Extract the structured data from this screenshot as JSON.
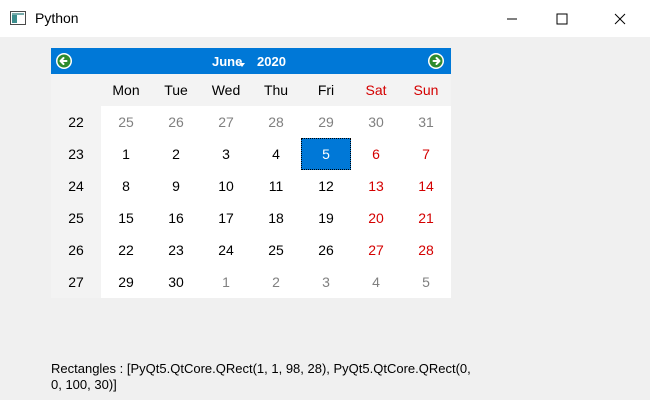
{
  "window": {
    "title": "Python",
    "buttons": [
      "minimize-icon",
      "maximize-icon",
      "close-icon"
    ]
  },
  "calendar": {
    "month": "June",
    "year": "2020",
    "nav": {
      "prev_icon": "left-arrow-icon",
      "next_icon": "right-arrow-icon",
      "month_menu_icon": "dropdown-icon"
    },
    "day_headers": [
      "Mon",
      "Tue",
      "Wed",
      "Thu",
      "Fri",
      "Sat",
      "Sun"
    ],
    "weeks": [
      {
        "number": "22",
        "days": [
          "25",
          "26",
          "27",
          "28",
          "29",
          "30",
          "31"
        ]
      },
      {
        "number": "23",
        "days": [
          "1",
          "2",
          "3",
          "4",
          "5",
          "6",
          "7"
        ]
      },
      {
        "number": "24",
        "days": [
          "8",
          "9",
          "10",
          "11",
          "12",
          "13",
          "14"
        ]
      },
      {
        "number": "25",
        "days": [
          "15",
          "16",
          "17",
          "18",
          "19",
          "20",
          "21"
        ]
      },
      {
        "number": "26",
        "days": [
          "22",
          "23",
          "24",
          "25",
          "26",
          "27",
          "28"
        ]
      },
      {
        "number": "27",
        "days": [
          "29",
          "30",
          "1",
          "2",
          "3",
          "4",
          "5"
        ]
      }
    ],
    "selected_day": "5",
    "colors": {
      "accent": "#0078d7",
      "weekend": "#d40000",
      "other_month": "#808080",
      "nav_arrow": "#2e8b2e"
    }
  },
  "output_text": "Rectangles : [PyQt5.QtCore.QRect(1, 1, 98, 28), PyQt5.QtCore.QRect(0, 0, 100, 30)]"
}
